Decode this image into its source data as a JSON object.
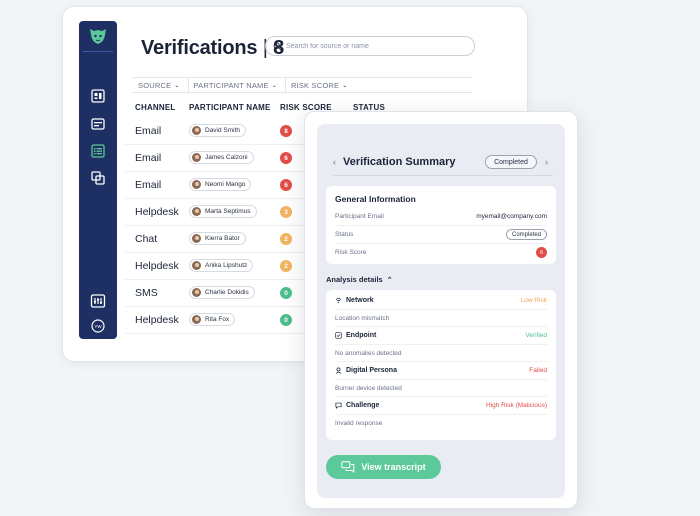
{
  "page": {
    "title": "Verifications",
    "count": "8",
    "search_placeholder": "Search for source or name"
  },
  "filters": [
    "SOURCE",
    "PARTICIPANT NAME",
    "RISK SCORE"
  ],
  "columns": [
    "CHANNEL",
    "PARTICIPANT NAME",
    "RISK SCORE",
    "STATUS"
  ],
  "rows": [
    {
      "channel": "Email",
      "name": "David Smith",
      "risk": "8",
      "risk_color": "#e04e47"
    },
    {
      "channel": "Email",
      "name": "James Calzoni",
      "risk": "6",
      "risk_color": "#e04e47"
    },
    {
      "channel": "Email",
      "name": "Neomi Mango",
      "risk": "6",
      "risk_color": "#e04e47"
    },
    {
      "channel": "Helpdesk",
      "name": "Marta Septimus",
      "risk": "3",
      "risk_color": "#f2b462"
    },
    {
      "channel": "Chat",
      "name": "Kierra Bator",
      "risk": "2",
      "risk_color": "#f2b462"
    },
    {
      "channel": "Helpdesk",
      "name": "Anika Lipshutz",
      "risk": "2",
      "risk_color": "#f2b462"
    },
    {
      "channel": "SMS",
      "name": "Charlie Dokidis",
      "risk": "0",
      "risk_color": "#4fbf8c"
    },
    {
      "channel": "Helpdesk",
      "name": "Rita Fox",
      "risk": "0",
      "risk_color": "#4fbf8c"
    }
  ],
  "summary": {
    "title": "Verification Summary",
    "status_badge": "Completed",
    "general": {
      "title": "General Information",
      "email_label": "Participant Email",
      "email_value": "myemail@company.com",
      "status_label": "Status",
      "status_value": "Completed",
      "risk_label": "Risk Score",
      "risk_value": "6"
    },
    "analysis_title": "Analysis details",
    "analysis": [
      {
        "label": "Network",
        "status": "Low Risk",
        "status_color": "#f2a65a",
        "detail": "Location mismatch",
        "icon": "wifi-icon"
      },
      {
        "label": "Endpoint",
        "status": "Verified",
        "status_color": "#4fbf8c",
        "detail": "No anomalies detected",
        "icon": "check-square-icon"
      },
      {
        "label": "Digital Persona",
        "status": "Failed",
        "status_color": "#e04e47",
        "detail": "Burner device detected",
        "icon": "user-icon"
      },
      {
        "label": "Challenge",
        "status": "High Risk (Malicious)",
        "status_color": "#e04e47",
        "detail": "Invalid response",
        "icon": "chat-icon"
      }
    ],
    "button_label": "View transcript"
  },
  "colors": {
    "sidebar": "#1e2f63",
    "accent_green": "#5cc99a"
  }
}
